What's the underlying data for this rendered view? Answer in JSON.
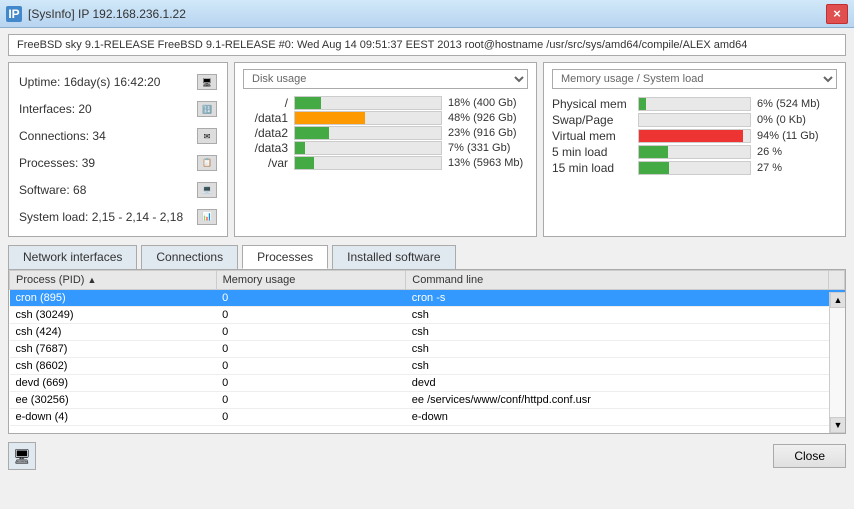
{
  "titlebar": {
    "icon_label": "IP",
    "title": "[SysInfo]  IP 192.168.236.1.22",
    "close_label": "×"
  },
  "infobar": {
    "text": "FreeBSD sky 9.1-RELEASE FreeBSD 9.1-RELEASE #0: Wed Aug 14 09:51:37 EEST 2013    root@hostname   /usr/src/sys/amd64/compile/ALEX amd64"
  },
  "sysinfo": {
    "uptime_label": "Uptime:",
    "uptime_value": "16day(s) 16:42:20",
    "interfaces_label": "Interfaces:",
    "interfaces_value": "20",
    "connections_label": "Connections:",
    "connections_value": "34",
    "processes_label": "Processes:",
    "processes_value": "39",
    "software_label": "Software:",
    "software_value": "68",
    "sysload_label": "System load:",
    "sysload_value": "2,15 - 2,14 - 2,18"
  },
  "disk_panel": {
    "title": "Disk usage",
    "dropdown_arrow": "▼",
    "rows": [
      {
        "label": "/",
        "pct": 18,
        "display": "18% (400 Gb)",
        "color": "green"
      },
      {
        "label": "/data1",
        "pct": 48,
        "display": "48% (926 Gb)",
        "color": "orange"
      },
      {
        "label": "/data2",
        "pct": 23,
        "display": "23% (916 Gb)",
        "color": "green"
      },
      {
        "label": "/data3",
        "pct": 7,
        "display": "7% (331 Gb)",
        "color": "green"
      },
      {
        "label": "/var",
        "pct": 13,
        "display": "13% (5963 Mb)",
        "color": "green"
      }
    ]
  },
  "memory_panel": {
    "title": "Memory usage / System load",
    "dropdown_arrow": "▼",
    "rows": [
      {
        "label": "Physical mem",
        "pct": 6,
        "display": "6% (524 Mb)",
        "color": "green"
      },
      {
        "label": "Swap/Page",
        "pct": 0,
        "display": "0% (0 Kb)",
        "color": "green"
      },
      {
        "label": "Virtual mem",
        "pct": 94,
        "display": "94% (11 Gb)",
        "color": "red"
      },
      {
        "label": "5 min load",
        "pct": 26,
        "display": "26 %",
        "color": "green"
      },
      {
        "label": "15 min load",
        "pct": 27,
        "display": "27 %",
        "color": "green"
      }
    ]
  },
  "tabs": [
    {
      "id": "network",
      "label": "Network interfaces"
    },
    {
      "id": "connections",
      "label": "Connections"
    },
    {
      "id": "processes",
      "label": "Processes"
    },
    {
      "id": "software",
      "label": "Installed software"
    }
  ],
  "active_tab": "processes",
  "table": {
    "columns": [
      "Process (PID)",
      "Memory usage",
      "Command line",
      ""
    ],
    "rows": [
      {
        "pid": "cron (895)",
        "mem": "0",
        "cmd": "cron -s",
        "selected": true
      },
      {
        "pid": "csh (30249)",
        "mem": "0",
        "cmd": "csh",
        "selected": false
      },
      {
        "pid": "csh (424)",
        "mem": "0",
        "cmd": "csh",
        "selected": false
      },
      {
        "pid": "csh (7687)",
        "mem": "0",
        "cmd": "csh",
        "selected": false
      },
      {
        "pid": "csh (8602)",
        "mem": "0",
        "cmd": "csh",
        "selected": false
      },
      {
        "pid": "devd (669)",
        "mem": "0",
        "cmd": "devd",
        "selected": false
      },
      {
        "pid": "ee (30256)",
        "mem": "0",
        "cmd": "ee /services/www/conf/httpd.conf.usr",
        "selected": false
      },
      {
        "pid": "e-down (4)",
        "mem": "0",
        "cmd": "e-down",
        "selected": false
      }
    ]
  },
  "bottom": {
    "close_label": "Close"
  },
  "icons": {
    "uptime": "🖥",
    "interfaces": "🔢",
    "connections": "✉",
    "processes": "📋",
    "software": "💻",
    "sysload": "📊",
    "scroll_up": "▲",
    "scroll_down": "▼",
    "sort_up": "▲"
  }
}
